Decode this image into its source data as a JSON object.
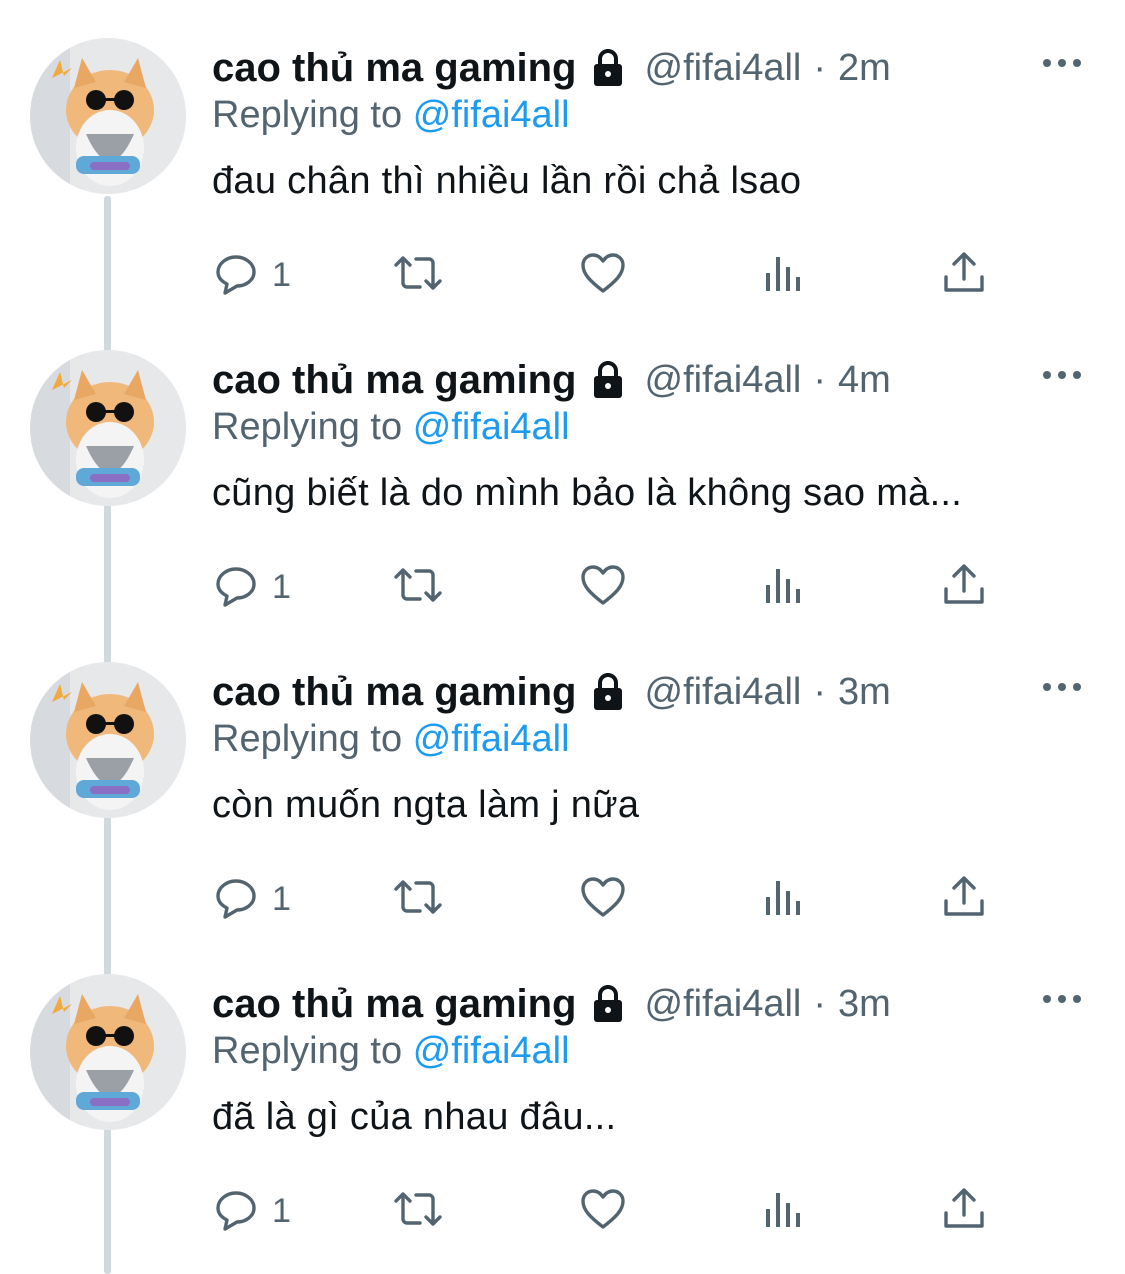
{
  "thread": {
    "tweets": [
      {
        "author_name": "cao thủ ma gaming",
        "handle": "@fifai4all",
        "separator": "·",
        "time": "4m",
        "replying_prefix": "Replying to",
        "replying_to": "@fifai4all",
        "text": "cũng biết là do mình bảo là không sao mà...",
        "reply_count": "1"
      },
      {
        "author_name": "cao thủ ma gaming",
        "handle": "@fifai4all",
        "separator": "·",
        "time": "3m",
        "replying_prefix": "Replying to",
        "replying_to": "@fifai4all",
        "text": "còn muốn ngta làm j nữa",
        "reply_count": "1"
      },
      {
        "author_name": "cao thủ ma gaming",
        "handle": "@fifai4all",
        "separator": "·",
        "time": "3m",
        "replying_prefix": "Replying to",
        "replying_to": "@fifai4all",
        "text": "đã là gì của nhau đâu...",
        "reply_count": "1"
      },
      {
        "author_name": "cao thủ ma gaming",
        "handle": "@fifai4all",
        "separator": "·",
        "time": "2m",
        "replying_prefix": "Replying to",
        "replying_to": "@fifai4all",
        "text": "đau chân thì nhiều lần rồi chả lsao",
        "reply_count": "1"
      }
    ]
  },
  "icons": {
    "lock": "lock-icon",
    "more": "more-icon",
    "reply": "reply-icon",
    "retweet": "retweet-icon",
    "like": "heart-icon",
    "views": "views-icon",
    "share": "share-icon"
  },
  "colors": {
    "text": "#0f1419",
    "secondary": "#536471",
    "mention": "#1d9bf0",
    "thread_line": "#cfd9de",
    "background": "#ffffff"
  }
}
